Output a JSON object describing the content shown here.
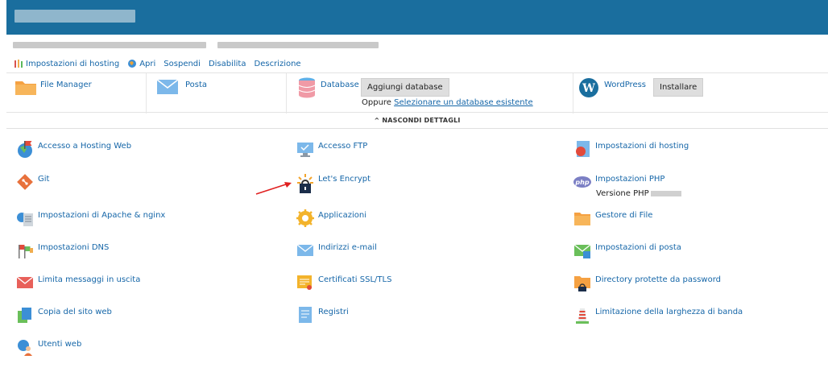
{
  "actions": [
    {
      "label": "Impostazioni di hosting",
      "icon": "hosting-settings-icon"
    },
    {
      "label": "Apri",
      "icon": "open-globe-icon"
    },
    {
      "label": "Sospendi"
    },
    {
      "label": "Disabilita"
    },
    {
      "label": "Descrizione"
    }
  ],
  "quickbar": {
    "file_manager": "File Manager",
    "posta": "Posta",
    "database": "Database",
    "add_database": "Aggiungi database",
    "oppure": "Oppure",
    "select_existing": "Selezionare un database esistente",
    "wordpress": "WordPress",
    "install": "Installare"
  },
  "hide_details": "NASCONDI DETTAGLI",
  "tools": {
    "col1": [
      "Accesso a Hosting Web",
      "Git",
      "Impostazioni di Apache & nginx",
      "Impostazioni DNS",
      "Limita messaggi in uscita",
      "Copia del sito web",
      "Utenti web"
    ],
    "col2": [
      "Accesso FTP",
      "Let's Encrypt",
      "Applicazioni",
      "Indirizzi e-mail",
      "Certificati SSL/TLS",
      "Registri"
    ],
    "col3": [
      "Impostazioni di hosting",
      "Impostazioni PHP",
      "Gestore di File",
      "Impostazioni di posta",
      "Directory protette da password",
      "Limitazione della larghezza di banda"
    ]
  },
  "php_version_label": "Versione PHP",
  "colors": {
    "header": "#1a6e9e",
    "link": "#1566a8",
    "arrow": "#e02020"
  }
}
